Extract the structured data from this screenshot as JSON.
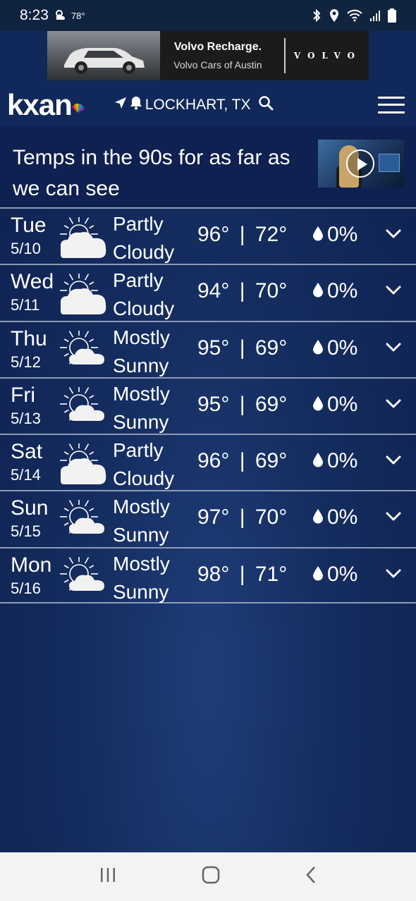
{
  "status_bar": {
    "time": "8:23",
    "temperature": "78°"
  },
  "ad": {
    "line1": "Volvo Recharge.",
    "line2": "Volvo Cars of Austin",
    "brand": "VOLVO"
  },
  "header": {
    "logo": "kxan",
    "location": "LOCKHART, TX"
  },
  "headline": {
    "text": "Temps in the 90s for as far as we can see"
  },
  "colors": {
    "header_bg": "#11285a",
    "page_bg": "#142c5e",
    "divider": "#8e9bb8"
  },
  "forecast": [
    {
      "day": "Tue",
      "date": "5/10",
      "condition_line1": "Partly",
      "condition_line2": "Cloudy",
      "icon": "partly-cloudy-icon",
      "high": "96°",
      "separator": "|",
      "low": "72°",
      "precip": "0%"
    },
    {
      "day": "Wed",
      "date": "5/11",
      "condition_line1": "Partly",
      "condition_line2": "Cloudy",
      "icon": "partly-cloudy-icon",
      "high": "94°",
      "separator": "|",
      "low": "70°",
      "precip": "0%"
    },
    {
      "day": "Thu",
      "date": "5/12",
      "condition_line1": "Mostly",
      "condition_line2": "Sunny",
      "icon": "mostly-sunny-icon",
      "high": "95°",
      "separator": "|",
      "low": "69°",
      "precip": "0%"
    },
    {
      "day": "Fri",
      "date": "5/13",
      "condition_line1": "Mostly",
      "condition_line2": "Sunny",
      "icon": "mostly-sunny-icon",
      "high": "95°",
      "separator": "|",
      "low": "69°",
      "precip": "0%"
    },
    {
      "day": "Sat",
      "date": "5/14",
      "condition_line1": "Partly",
      "condition_line2": "Cloudy",
      "icon": "partly-cloudy-icon",
      "high": "96°",
      "separator": "|",
      "low": "69°",
      "precip": "0%"
    },
    {
      "day": "Sun",
      "date": "5/15",
      "condition_line1": "Mostly",
      "condition_line2": "Sunny",
      "icon": "mostly-sunny-icon",
      "high": "97°",
      "separator": "|",
      "low": "70°",
      "precip": "0%"
    },
    {
      "day": "Mon",
      "date": "5/16",
      "condition_line1": "Mostly",
      "condition_line2": "Sunny",
      "icon": "mostly-sunny-icon",
      "high": "98°",
      "separator": "|",
      "low": "71°",
      "precip": "0%"
    }
  ]
}
